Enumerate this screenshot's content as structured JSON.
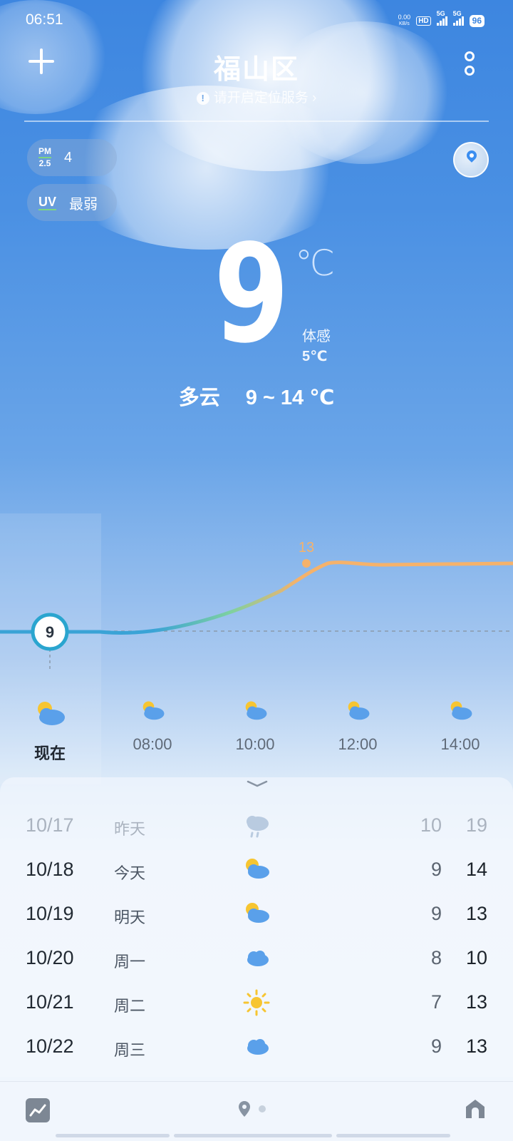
{
  "status_bar": {
    "time": "06:51",
    "net_speed": "0.00",
    "net_unit": "KB/s",
    "hd_label": "HD",
    "sim_label": "5G",
    "battery": "96"
  },
  "header": {
    "city": "福山区",
    "location_hint": "请开启定位服务 ›"
  },
  "indicators": {
    "pm_label_top": "PM",
    "pm_label_bottom": "2.5",
    "pm_value": "4",
    "uv_label": "UV",
    "uv_value": "最弱"
  },
  "current": {
    "temp": "9",
    "unit": "℃",
    "feel_label": "体感",
    "feel_value": "5℃",
    "condition": "多云",
    "range": "9 ~ 14 ℃"
  },
  "hourly": {
    "now_temp": "9",
    "peak_temp": "13",
    "items": [
      {
        "label": "现在",
        "icon": "partly-cloudy-icon"
      },
      {
        "label": "08:00",
        "icon": "partly-cloudy-icon"
      },
      {
        "label": "10:00",
        "icon": "partly-cloudy-icon"
      },
      {
        "label": "12:00",
        "icon": "partly-cloudy-icon"
      },
      {
        "label": "14:00",
        "icon": "partly-cloudy-icon"
      }
    ]
  },
  "daily": [
    {
      "date": "10/17",
      "day": "昨天",
      "icon": "rain-cloud-icon",
      "low": "10",
      "high": "19"
    },
    {
      "date": "10/18",
      "day": "今天",
      "icon": "partly-cloudy-icon",
      "low": "9",
      "high": "14"
    },
    {
      "date": "10/19",
      "day": "明天",
      "icon": "partly-cloudy-icon",
      "low": "9",
      "high": "13"
    },
    {
      "date": "10/20",
      "day": "周一",
      "icon": "cloud-icon",
      "low": "8",
      "high": "10"
    },
    {
      "date": "10/21",
      "day": "周二",
      "icon": "sun-icon",
      "low": "7",
      "high": "13"
    },
    {
      "date": "10/22",
      "day": "周三",
      "icon": "cloud-icon",
      "low": "9",
      "high": "13"
    }
  ],
  "colors": {
    "sky_top": "#3d86e0",
    "curve_start": "#3aa3d6",
    "curve_end": "#f5b26b",
    "sun": "#f7c531",
    "cloud": "#5aa0ea"
  }
}
